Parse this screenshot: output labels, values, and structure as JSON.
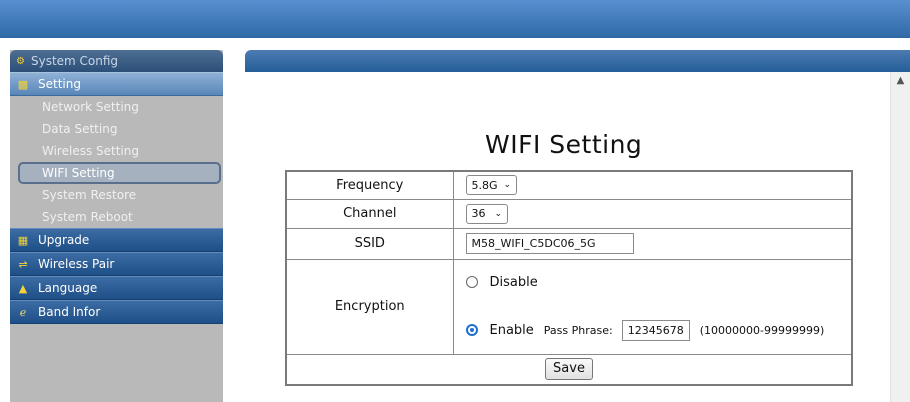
{
  "sidebar": {
    "header": "System Config",
    "setting_label": "Setting",
    "sub_items": [
      {
        "label": "Network Setting"
      },
      {
        "label": "Data Setting"
      },
      {
        "label": "Wireless Setting"
      },
      {
        "label": "WIFI Setting",
        "active": true
      },
      {
        "label": "System Restore"
      },
      {
        "label": "System Reboot"
      }
    ],
    "groups": [
      {
        "label": "Upgrade",
        "icon": "disk-icon"
      },
      {
        "label": "Wireless Pair",
        "icon": "pair-icon"
      },
      {
        "label": "Language",
        "icon": "home-icon"
      },
      {
        "label": "Band Infor",
        "icon": "info-icon"
      }
    ]
  },
  "main": {
    "title": "WIFI Setting",
    "frequency": {
      "label": "Frequency",
      "value": "5.8G"
    },
    "channel": {
      "label": "Channel",
      "value": "36"
    },
    "ssid": {
      "label": "SSID",
      "value": "M58_WIFI_C5DC06_5G"
    },
    "encryption": {
      "label": "Encryption",
      "disable_label": "Disable",
      "enable_label": "Enable",
      "selected": "Enable",
      "pass_phrase_label": "Pass Phrase:",
      "pass_phrase_value": "12345678",
      "range_hint": "(10000000-99999999)"
    },
    "save_label": "Save"
  },
  "colors": {
    "topbar": "#3f77b8",
    "sidebar_bg": "#b9b9b9",
    "radio_accent": "#1f6fd1"
  }
}
